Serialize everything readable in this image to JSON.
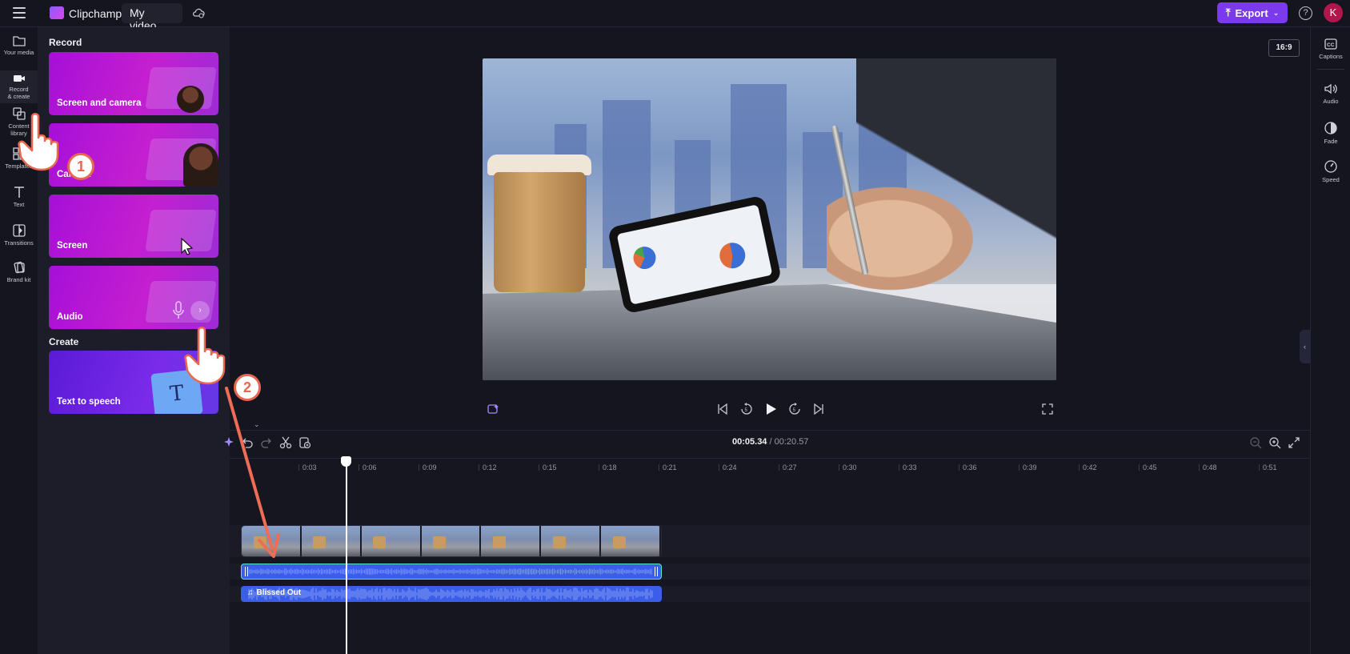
{
  "topbar": {
    "app_name": "Clipchamp",
    "project_name": "My video",
    "export_label": "Export",
    "help_label": "?",
    "avatar_initial": "K",
    "brand_color": "#7c3aed"
  },
  "leftrail": {
    "items": [
      {
        "label": "Your media",
        "icon": "folder-icon"
      },
      {
        "label": "Record & create",
        "icon": "video-camera-icon",
        "active": true
      },
      {
        "label": "Content library",
        "icon": "library-icon"
      },
      {
        "label": "Templates",
        "icon": "templates-icon"
      },
      {
        "label": "Text",
        "icon": "text-icon"
      },
      {
        "label": "Transitions",
        "icon": "transitions-icon"
      },
      {
        "label": "Brand kit",
        "icon": "brand-kit-icon"
      }
    ]
  },
  "panel": {
    "record_heading": "Record",
    "create_heading": "Create",
    "record_cards": [
      {
        "label": "Screen and camera"
      },
      {
        "label": "Camera"
      },
      {
        "label": "Screen"
      },
      {
        "label": "Audio"
      }
    ],
    "create_cards": [
      {
        "label": "Text to speech"
      }
    ]
  },
  "preview": {
    "aspect_ratio": "16:9"
  },
  "rightrail": {
    "items": [
      {
        "label": "Captions",
        "icon": "captions-icon"
      },
      {
        "label": "Audio",
        "icon": "speaker-icon"
      },
      {
        "label": "Fade",
        "icon": "fade-icon"
      },
      {
        "label": "Speed",
        "icon": "speedometer-icon"
      }
    ]
  },
  "timeline": {
    "current_time": "00:05.34",
    "separator": " / ",
    "total_time": "00:20.57",
    "ruler_ticks": [
      "0:03",
      "0:06",
      "0:09",
      "0:12",
      "0:15",
      "0:18",
      "0:21",
      "0:24",
      "0:27",
      "0:30",
      "0:33",
      "0:36",
      "0:39",
      "0:42",
      "0:45",
      "0:48",
      "0:51"
    ],
    "music_clip_label": "Blissed Out"
  },
  "tutorial": {
    "step1": "1",
    "step2": "2",
    "accent_color": "#e8674e"
  }
}
